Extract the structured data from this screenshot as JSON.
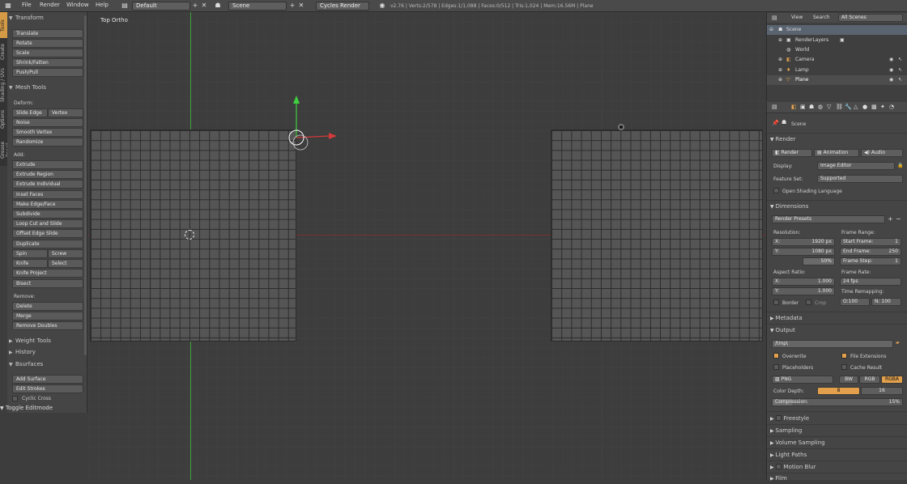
{
  "topbar": {
    "menus": [
      "File",
      "Render",
      "Window",
      "Help"
    ],
    "layout": "Default",
    "scene": "Scene",
    "engine": "Cycles Render",
    "stats": "v2.76 | Verts:2/578 | Edges:1/1,088 | Faces:0/512 | Tris:1,024 | Mem:16.56M | Plane"
  },
  "left_tabs": [
    "Tools",
    "Create",
    "Shading / UVs",
    "Options",
    "Grease Pencil"
  ],
  "shelf": {
    "transform": {
      "header": "Transform",
      "buttons": [
        "Translate",
        "Rotate",
        "Scale",
        "Shrink/Fatten",
        "Push/Pull"
      ]
    },
    "mesh_tools": {
      "header": "Mesh Tools",
      "deform_label": "Deform:",
      "slide_edge": "Slide Edge",
      "vertex": "Vertex",
      "noise": "Noise",
      "smooth_vertex": "Smooth Vertex",
      "randomize": "Randomize",
      "add_label": "Add:",
      "extrude": "Extrude",
      "extrude_region": "Extrude Region",
      "extrude_individual": "Extrude Individual",
      "inset_faces": "Inset Faces",
      "make_edge_face": "Make Edge/Face",
      "subdivide": "Subdivide",
      "loop_cut": "Loop Cut and Slide",
      "offset_edge": "Offset Edge Slide",
      "duplicate": "Duplicate",
      "spin": "Spin",
      "screw": "Screw",
      "knife": "Knife",
      "select": "Select",
      "knife_project": "Knife Project",
      "bisect": "Bisect",
      "remove_label": "Remove:",
      "delete": "Delete",
      "merge": "Merge",
      "remove_doubles": "Remove Doubles"
    },
    "weight_tools": "Weight Tools",
    "history": "History",
    "bsurfaces": {
      "header": "Bsurfaces",
      "add_surface": "Add Surface",
      "edit_strokes": "Edit Strokes",
      "cyclic_cross": "Cyclic Cross"
    },
    "toggle_editmode": "Toggle Editmode"
  },
  "viewport": {
    "view_label": "Top Ortho"
  },
  "outliner": {
    "view": "View",
    "search": "Search",
    "filter": "All Scenes",
    "items": {
      "scene": "Scene",
      "render_layers": "RenderLayers",
      "world": "World",
      "camera": "Camera",
      "lamp": "Lamp",
      "plane": "Plane"
    }
  },
  "properties": {
    "scene_path": "Scene",
    "render": {
      "header": "Render",
      "render_btn": "Render",
      "animation_btn": "Animation",
      "audio_btn": "Audio",
      "display_label": "Display:",
      "display_value": "Image Editor",
      "feature_label": "Feature Set:",
      "feature_value": "Supported",
      "osl": "Open Shading Language"
    },
    "dimensions": {
      "header": "Dimensions",
      "presets": "Render Presets",
      "resolution_label": "Resolution:",
      "res_x_label": "X:",
      "res_x": "1920 px",
      "res_y_label": "Y:",
      "res_y": "1080 px",
      "res_pct": "50%",
      "frame_range_label": "Frame Range:",
      "start_label": "Start Frame:",
      "start": "1",
      "end_label": "End Frame:",
      "end": "250",
      "step_label": "Frame Step:",
      "step": "1",
      "aspect_label": "Aspect Ratio:",
      "aspect_x_label": "X:",
      "aspect_x": "1.000",
      "aspect_y_label": "Y:",
      "aspect_y": "1.000",
      "frame_rate_label": "Frame Rate:",
      "frame_rate": "24 fps",
      "time_remap_label": "Time Remapping:",
      "remap_old": "O:100",
      "remap_new": "N: 100",
      "border": "Border",
      "crop": "Crop"
    },
    "metadata": "Metadata",
    "output": {
      "header": "Output",
      "path": "/tmp\\",
      "overwrite": "Overwrite",
      "file_extensions": "File Extensions",
      "placeholders": "Placeholders",
      "cache_result": "Cache Result",
      "format": "PNG",
      "bw": "BW",
      "rgb": "RGB",
      "rgba": "RGBA",
      "color_depth_label": "Color Depth:",
      "depth_8": "8",
      "depth_16": "16",
      "compression_label": "Compression:",
      "compression": "15%"
    },
    "collapsed": [
      "Freestyle",
      "Sampling",
      "Volume Sampling",
      "Light Paths",
      "Motion Blur",
      "Film"
    ]
  },
  "colors": {
    "accent": "#e2a04d",
    "x_axis": "#d23a3a",
    "y_axis": "#4fc04f",
    "selection": "#ffffff"
  }
}
